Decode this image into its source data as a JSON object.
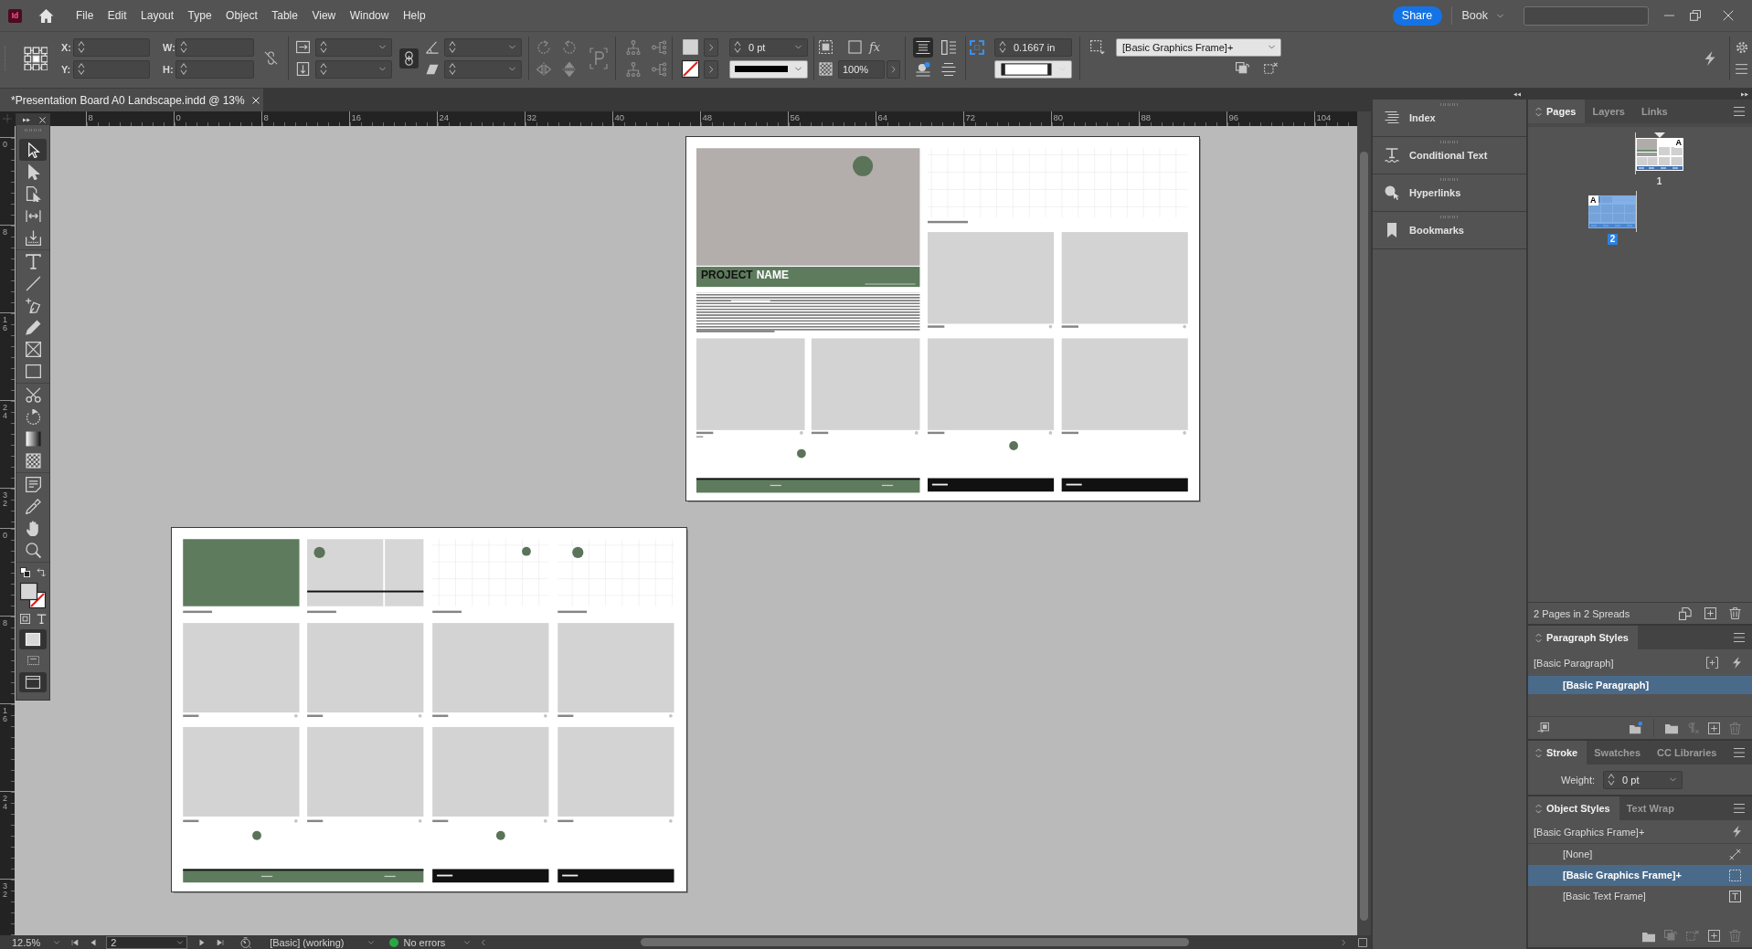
{
  "app": {
    "logo": "Id"
  },
  "menu": [
    "File",
    "Edit",
    "Layout",
    "Type",
    "Object",
    "Table",
    "View",
    "Window",
    "Help"
  ],
  "header": {
    "share": "Share",
    "workspace": "Book"
  },
  "control_bar": {
    "position_labels": [
      "X:",
      "Y:"
    ],
    "size_labels": [
      "W:",
      "H:"
    ],
    "constrain_size": {
      "on": false
    },
    "constrain_scale": {
      "on": true
    },
    "stroke_weight": "0 pt",
    "effects": "fx",
    "opacity": "100%",
    "option_buttons": [
      {
        "selected": true
      },
      {
        "selected": false
      }
    ],
    "corner_size": "0.1667 in",
    "object_style": "[Basic Graphics Frame]+"
  },
  "document_tab": {
    "title": "*Presentation Board A0 Landscape.indd @ 13%"
  },
  "rulers": {
    "horizontal": [
      "8",
      "0",
      "8",
      "16",
      "24",
      "32",
      "40",
      "48",
      "56",
      "64",
      "72",
      "80",
      "88",
      "96",
      "104"
    ],
    "vertical": [
      [
        "0",
        "8",
        "16",
        "24",
        "32"
      ],
      [
        "0",
        "8",
        "16",
        "24",
        "32"
      ]
    ]
  },
  "tool_groups": [
    [
      {
        "kind": "selection",
        "selected": true
      },
      {
        "kind": "direct-selection",
        "selected": false
      },
      {
        "kind": "page",
        "selected": false
      },
      {
        "kind": "gap",
        "selected": false
      },
      {
        "kind": "content-collector",
        "selected": false
      }
    ],
    [
      {
        "kind": "type",
        "selected": false
      },
      {
        "kind": "line",
        "selected": false
      },
      {
        "kind": "pen",
        "selected": false
      },
      {
        "kind": "pencil",
        "selected": false
      },
      {
        "kind": "frame",
        "selected": false
      },
      {
        "kind": "rectangle",
        "selected": false
      }
    ],
    [
      {
        "kind": "scissors",
        "selected": false
      },
      {
        "kind": "free-transform",
        "selected": false
      },
      {
        "kind": "gradient",
        "selected": false
      },
      {
        "kind": "gradient-feather",
        "selected": false
      }
    ],
    [
      {
        "kind": "note",
        "selected": false
      },
      {
        "kind": "eyedropper",
        "selected": false
      },
      {
        "kind": "hand",
        "selected": false
      },
      {
        "kind": "zoom",
        "selected": false
      }
    ]
  ],
  "canvas": {
    "title_words": [
      {
        "text": "PROJECT",
        "kind": "dark"
      },
      {
        "text": "NAME",
        "kind": "light"
      }
    ]
  },
  "dock_panels": [
    {
      "label": "Index",
      "kind": "index"
    },
    {
      "label": "Conditional Text",
      "kind": "conditional-text"
    },
    {
      "label": "Hyperlinks",
      "kind": "hyperlinks"
    },
    {
      "label": "Bookmarks",
      "kind": "bookmarks"
    }
  ],
  "pages_panel": {
    "tabs": [
      {
        "label": "Pages",
        "selected": true
      },
      {
        "label": "Layers",
        "selected": false
      },
      {
        "label": "Links",
        "selected": false
      }
    ],
    "thumbnails": [
      {
        "number": "1",
        "master": "A",
        "kind": "recto",
        "selected": false
      },
      {
        "number": "2",
        "master": "A",
        "kind": "verso",
        "selected": true
      }
    ],
    "summary": "2 Pages in 2 Spreads"
  },
  "paragraph_styles": {
    "tabs": [
      {
        "label": "Paragraph Styles",
        "selected": true
      }
    ],
    "current": "[Basic Paragraph]",
    "items": [
      {
        "label": "[Basic Paragraph]",
        "selected": true
      }
    ]
  },
  "stroke_panel": {
    "tabs": [
      {
        "label": "Stroke",
        "selected": true
      },
      {
        "label": "Swatches",
        "selected": false
      },
      {
        "label": "CC Libraries",
        "selected": false
      }
    ],
    "weight_label": "Weight:",
    "weight": "0 pt"
  },
  "object_styles": {
    "tabs": [
      {
        "label": "Object Styles",
        "selected": true
      },
      {
        "label": "Text Wrap",
        "selected": false
      }
    ],
    "current": "[Basic Graphics Frame]+",
    "items": [
      {
        "label": "[None]",
        "kind": "none",
        "selected": false
      },
      {
        "label": "[Basic Graphics Frame]+",
        "kind": "graphics-frame",
        "selected": true
      },
      {
        "label": "[Basic Text Frame]",
        "kind": "text-frame",
        "selected": false
      }
    ]
  },
  "status_bar": {
    "zoom": "12.5%",
    "page": "2",
    "profile": "[Basic] (working)",
    "preflight": "No errors",
    "ok": true
  }
}
